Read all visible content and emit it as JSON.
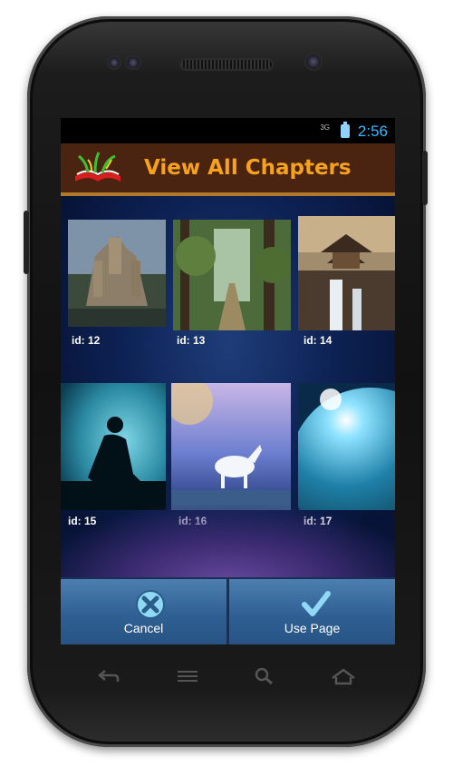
{
  "status": {
    "network": "3G",
    "time": "2:56"
  },
  "app": {
    "title": "View All Chapters",
    "logo_icon": "book-with-plants-logo"
  },
  "chapters": [
    {
      "label": "id: 12",
      "scene": "castle"
    },
    {
      "label": "id: 13",
      "scene": "forest-path"
    },
    {
      "label": "id: 14",
      "scene": "pagoda-waterfall"
    },
    {
      "label": "id: 15",
      "scene": "silhouette-sitting"
    },
    {
      "label": "id: 16",
      "scene": "unicorn"
    },
    {
      "label": "id: 17",
      "scene": "planet"
    }
  ],
  "actions": {
    "cancel": {
      "label": "Cancel",
      "icon": "x-circle-icon"
    },
    "use_page": {
      "label": "Use Page",
      "icon": "checkmark-icon"
    }
  },
  "nav": [
    "back-icon",
    "menu-icon",
    "search-icon",
    "home-icon"
  ],
  "colors": {
    "title": "#f7a21c",
    "appbar": "#4a2411",
    "clock": "#3ab8ff",
    "button_bg": "#2f5f93"
  }
}
